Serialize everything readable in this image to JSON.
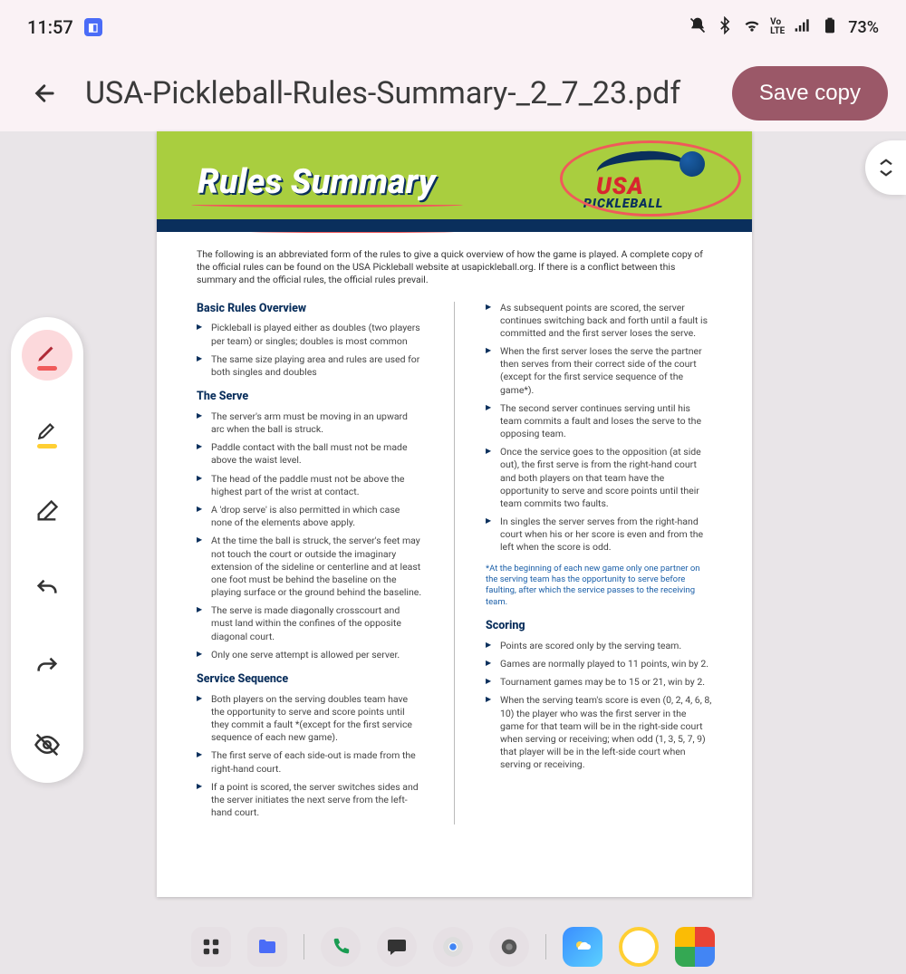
{
  "statusbar": {
    "time": "11:57",
    "battery": "73%"
  },
  "header": {
    "filename": "USA-Pickleball-Rules-Summary-_2_7_23.pdf",
    "save_label": "Save copy"
  },
  "document": {
    "title": "Rules Summary",
    "logo_usa": "USA",
    "logo_pb": "PICKLEBALL",
    "intro": "The following is an abbreviated form of the rules to give a quick overview of how the game is played. A complete copy of the official rules can be found on the USA Pickleball website at usapickleball.org. If there is a conflict between this summary and the official rules, the official rules prevail.",
    "sections_left": [
      {
        "title": "Basic Rules Overview",
        "items": [
          "Pickleball is played either as doubles (two players per team) or singles; doubles is most common",
          "The same size playing area and rules are used for both singles and doubles"
        ]
      },
      {
        "title": "The Serve",
        "items": [
          "The server's arm must be moving in an upward arc when the ball is struck.",
          "Paddle contact with the ball must not be made above the waist level.",
          "The head of the paddle must not be above the highest part of the wrist at contact.",
          "A 'drop serve' is also permitted in which case none of the elements above apply.",
          "At the time the ball is struck, the server's feet may not touch the court or outside the imaginary extension of the sideline or centerline and at least one foot must be behind the baseline on the playing surface or the ground behind the baseline.",
          "The serve is made diagonally crosscourt and must land within the confines of the opposite diagonal court.",
          "Only one serve attempt is allowed per server."
        ]
      },
      {
        "title": "Service Sequence",
        "items": [
          "Both players on the serving doubles team have the opportunity to serve and score points until they commit a fault *(except for the first service sequence of each new game).",
          "The first serve of each side-out is made from the right-hand court.",
          "If a point is scored, the server switches sides and the server initiates the next serve from the left-hand court."
        ]
      }
    ],
    "right_continuation": [
      "As subsequent points are scored, the server continues switching back and forth until a fault is committed and the first server loses the serve.",
      "When the first server loses the serve the partner then serves from their correct side of the court (except for the first service sequence of the game*).",
      "The second server continues serving until his team commits a fault and loses the serve to the opposing team.",
      "Once the service goes to the opposition (at side out), the first serve is from the right-hand court and both players on that team have the opportunity to serve and score points until their team commits two faults.",
      "In singles the server serves from the right-hand court when his or her score is even and from the left when the score is odd."
    ],
    "footnote": "*At the beginning of each new game only one partner on the serving team has the opportunity to serve before faulting, after which the service passes to the receiving team.",
    "scoring": {
      "title": "Scoring",
      "items": [
        "Points are scored only by the serving team.",
        "Games are normally played to 11 points, win by 2.",
        "Tournament games may be to 15 or 21, win by 2.",
        "When the serving team's score is even (0, 2, 4, 6, 8, 10) the player who was the first server in the game for that team will be in the right-side court when serving or receiving; when odd (1, 3, 5, 7, 9) that player will be in the left-side court when serving or receiving."
      ]
    }
  }
}
